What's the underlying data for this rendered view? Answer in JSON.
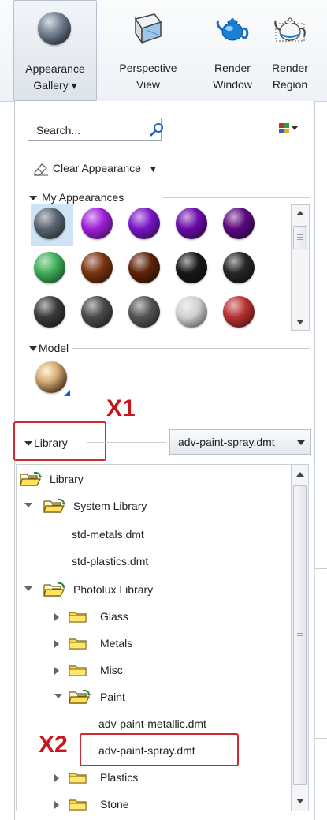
{
  "ribbon": {
    "appearance_gallery_line1": "Appearance",
    "appearance_gallery_line2": "Gallery ▾",
    "perspective_line1": "Perspective",
    "perspective_line2": "View",
    "render_window_line1": "Render",
    "render_window_line2": "Window",
    "render_region_line1": "Render",
    "render_region_line2": "Region"
  },
  "search": {
    "placeholder": "Search..."
  },
  "clear_appearance": {
    "label": "Clear Appearance",
    "dropdown": "▼"
  },
  "sections": {
    "my_appearances": "My Appearances",
    "model": "Model",
    "library": "Library"
  },
  "my_appearances": [
    {
      "color": "#5a6470",
      "selected": true
    },
    {
      "color": "#a020d8"
    },
    {
      "color": "#7a16c8"
    },
    {
      "color": "#6a0aa8"
    },
    {
      "color": "#5c087e"
    },
    {
      "color": "#3fae58"
    },
    {
      "color": "#7a3410"
    },
    {
      "color": "#5e2408"
    },
    {
      "color": "#181818"
    },
    {
      "color": "#262626"
    },
    {
      "color": "#3a3a3a"
    },
    {
      "color": "#4a4a4a"
    },
    {
      "color": "#555555"
    },
    {
      "color": "#d0d0d0"
    },
    {
      "color": "#b83030"
    }
  ],
  "library_select": {
    "value": "adv-paint-spray.dmt"
  },
  "annotations": {
    "x1": "X1",
    "x2": "X2"
  },
  "tree": {
    "root": "Library",
    "system_library": "System Library",
    "std_metals": "std-metals.dmt",
    "std_plastics": "std-plastics.dmt",
    "photolux_library": "Photolux Library",
    "glass": "Glass",
    "metals": "Metals",
    "misc": "Misc",
    "paint": "Paint",
    "adv_paint_metallic": "adv-paint-metallic.dmt",
    "adv_paint_spray": "adv-paint-spray.dmt",
    "plastics": "Plastics",
    "stone": "Stone"
  }
}
